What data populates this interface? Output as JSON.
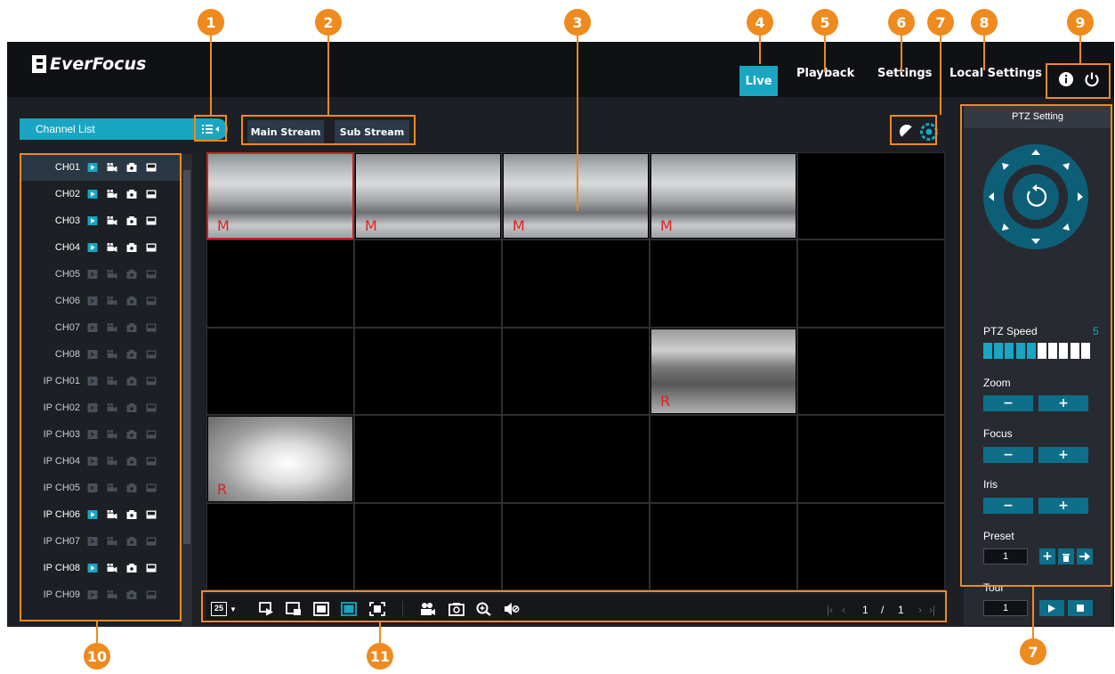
{
  "callouts": [
    "1",
    "2",
    "3",
    "4",
    "5",
    "6",
    "7",
    "8",
    "9",
    "10",
    "11",
    "7"
  ],
  "app": {
    "logo_text": "EverFocus",
    "nav": {
      "live": "Live",
      "playback": "Playback",
      "settings": "Settings",
      "local_settings": "Local Settings"
    },
    "header_icons": [
      "info-icon",
      "power-icon"
    ]
  },
  "channel_panel": {
    "title": "Channel List",
    "channels": [
      {
        "name": "CH01",
        "online": true
      },
      {
        "name": "CH02",
        "online": true
      },
      {
        "name": "CH03",
        "online": true
      },
      {
        "name": "CH04",
        "online": true
      },
      {
        "name": "CH05",
        "online": false
      },
      {
        "name": "CH06",
        "online": false
      },
      {
        "name": "CH07",
        "online": false
      },
      {
        "name": "CH08",
        "online": false
      },
      {
        "name": "IP CH01",
        "online": false
      },
      {
        "name": "IP CH02",
        "online": false
      },
      {
        "name": "IP CH03",
        "online": false
      },
      {
        "name": "IP CH04",
        "online": false
      },
      {
        "name": "IP CH05",
        "online": false
      },
      {
        "name": "IP CH06",
        "online": true
      },
      {
        "name": "IP CH07",
        "online": false
      },
      {
        "name": "IP CH08",
        "online": true
      },
      {
        "name": "IP CH09",
        "online": false
      }
    ]
  },
  "streams": {
    "main": "Main Stream",
    "sub": "Sub Stream"
  },
  "video_grid": {
    "layout": "25",
    "markers": {
      "main": "M",
      "record": "R"
    }
  },
  "toolbar": {
    "layout_label": "25",
    "page_current": "1",
    "page_sep": "/",
    "page_total": "1"
  },
  "ptz": {
    "title": "PTZ Setting",
    "speed_label": "PTZ Speed",
    "speed_value": "5",
    "speed_level": 5,
    "speed_max": 10,
    "zoom_label": "Zoom",
    "focus_label": "Focus",
    "iris_label": "Iris",
    "preset_label": "Preset",
    "preset_value": "1",
    "tour_label": "Tour",
    "tour_value": "1",
    "minus": "−",
    "plus": "+"
  },
  "colors": {
    "accent": "#19a6c2",
    "callout": "#ef8a1e"
  }
}
